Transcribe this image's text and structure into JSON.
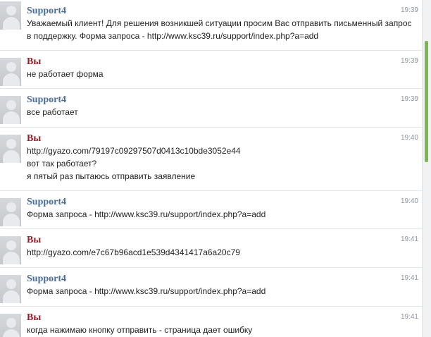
{
  "messages": [
    {
      "author": "Support4",
      "time": "19:39",
      "lines": [
        "Уважаемый клиент! Для решения возникшей ситуации просим Вас отправить письменный запрос",
        "в поддержку. Форма запроса - http://www.ksc39.ru/support/index.php?a=add"
      ]
    },
    {
      "author": "Вы",
      "time": "19:39",
      "lines": [
        "не работает форма"
      ]
    },
    {
      "author": "Support4",
      "time": "19:39",
      "lines": [
        "все работает"
      ]
    },
    {
      "author": "Вы",
      "time": "19:40",
      "lines": [
        "http://gyazo.com/79197c09297507d0413c10bde3052e44",
        "вот так работает?",
        "я пятый раз пытаюсь отправить заявление"
      ]
    },
    {
      "author": "Support4",
      "time": "19:40",
      "lines": [
        "Форма запроса - http://www.ksc39.ru/support/index.php?a=add"
      ]
    },
    {
      "author": "Вы",
      "time": "19:41",
      "lines": [
        "http://gyazo.com/e7c67b96acd1e539d4341417a6a20c79"
      ]
    },
    {
      "author": "Support4",
      "time": "19:41",
      "lines": [
        "Форма запроса - http://www.ksc39.ru/support/index.php?a=add"
      ]
    },
    {
      "author": "Вы",
      "time": "19:41",
      "lines": [
        "когда нажимаю кнопку отправить - страница дает ошибку"
      ]
    }
  ],
  "colors": {
    "support_author": "#4a6d99",
    "me_author": "#9a1c24",
    "scroll_thumb": "#7cb84f"
  }
}
